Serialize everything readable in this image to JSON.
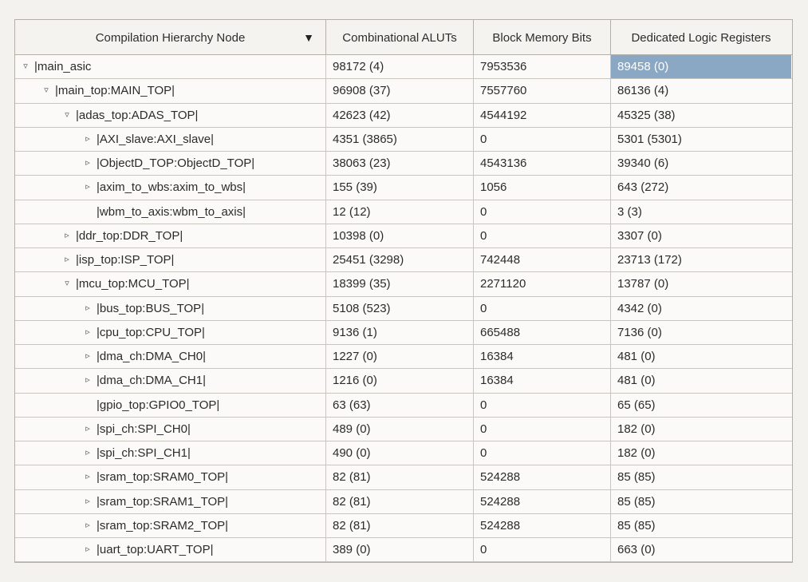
{
  "columns": {
    "node": "Compilation Hierarchy Node",
    "aluts": "Combinational ALUTs",
    "mem": "Block Memory Bits",
    "reg": "Dedicated Logic Registers"
  },
  "rows": [
    {
      "indent": 0,
      "expander": "open",
      "name": "|main_asic",
      "aluts": "98172 (4)",
      "mem": "7953536",
      "reg": "89458 (0)",
      "reg_selected": true
    },
    {
      "indent": 1,
      "expander": "open",
      "name": "|main_top:MAIN_TOP|",
      "aluts": "96908 (37)",
      "mem": "7557760",
      "reg": "86136 (4)"
    },
    {
      "indent": 2,
      "expander": "open",
      "name": "|adas_top:ADAS_TOP|",
      "aluts": "42623 (42)",
      "mem": "4544192",
      "reg": "45325 (38)"
    },
    {
      "indent": 3,
      "expander": "closed",
      "name": "|AXI_slave:AXI_slave|",
      "aluts": "4351 (3865)",
      "mem": "0",
      "reg": "5301 (5301)"
    },
    {
      "indent": 3,
      "expander": "closed",
      "name": "|ObjectD_TOP:ObjectD_TOP|",
      "aluts": "38063 (23)",
      "mem": "4543136",
      "reg": "39340 (6)"
    },
    {
      "indent": 3,
      "expander": "closed",
      "name": "|axim_to_wbs:axim_to_wbs|",
      "aluts": "155 (39)",
      "mem": "1056",
      "reg": "643 (272)"
    },
    {
      "indent": 3,
      "expander": "none",
      "name": "|wbm_to_axis:wbm_to_axis|",
      "aluts": "12 (12)",
      "mem": "0",
      "reg": "3 (3)"
    },
    {
      "indent": 2,
      "expander": "closed",
      "name": "|ddr_top:DDR_TOP|",
      "aluts": "10398 (0)",
      "mem": "0",
      "reg": "3307 (0)"
    },
    {
      "indent": 2,
      "expander": "closed",
      "name": "|isp_top:ISP_TOP|",
      "aluts": "25451 (3298)",
      "mem": "742448",
      "reg": "23713 (172)"
    },
    {
      "indent": 2,
      "expander": "open",
      "name": "|mcu_top:MCU_TOP|",
      "aluts": "18399 (35)",
      "mem": "2271120",
      "reg": "13787 (0)"
    },
    {
      "indent": 3,
      "expander": "closed",
      "name": "|bus_top:BUS_TOP|",
      "aluts": "5108 (523)",
      "mem": "0",
      "reg": "4342 (0)"
    },
    {
      "indent": 3,
      "expander": "closed",
      "name": "|cpu_top:CPU_TOP|",
      "aluts": "9136 (1)",
      "mem": "665488",
      "reg": "7136 (0)"
    },
    {
      "indent": 3,
      "expander": "closed",
      "name": "|dma_ch:DMA_CH0|",
      "aluts": "1227 (0)",
      "mem": "16384",
      "reg": "481 (0)"
    },
    {
      "indent": 3,
      "expander": "closed",
      "name": "|dma_ch:DMA_CH1|",
      "aluts": "1216 (0)",
      "mem": "16384",
      "reg": "481 (0)"
    },
    {
      "indent": 3,
      "expander": "none",
      "name": "|gpio_top:GPIO0_TOP|",
      "aluts": "63 (63)",
      "mem": "0",
      "reg": "65 (65)"
    },
    {
      "indent": 3,
      "expander": "closed",
      "name": "|spi_ch:SPI_CH0|",
      "aluts": "489 (0)",
      "mem": "0",
      "reg": "182 (0)"
    },
    {
      "indent": 3,
      "expander": "closed",
      "name": "|spi_ch:SPI_CH1|",
      "aluts": "490 (0)",
      "mem": "0",
      "reg": "182 (0)"
    },
    {
      "indent": 3,
      "expander": "closed",
      "name": "|sram_top:SRAM0_TOP|",
      "aluts": "82 (81)",
      "mem": "524288",
      "reg": "85 (85)"
    },
    {
      "indent": 3,
      "expander": "closed",
      "name": "|sram_top:SRAM1_TOP|",
      "aluts": "82 (81)",
      "mem": "524288",
      "reg": "85 (85)"
    },
    {
      "indent": 3,
      "expander": "closed",
      "name": "|sram_top:SRAM2_TOP|",
      "aluts": "82 (81)",
      "mem": "524288",
      "reg": "85 (85)"
    },
    {
      "indent": 3,
      "expander": "closed",
      "name": "|uart_top:UART_TOP|",
      "aluts": "389 (0)",
      "mem": "0",
      "reg": "663 (0)"
    }
  ],
  "expander_glyphs": {
    "open": "▿",
    "closed": "▹",
    "none": ""
  }
}
